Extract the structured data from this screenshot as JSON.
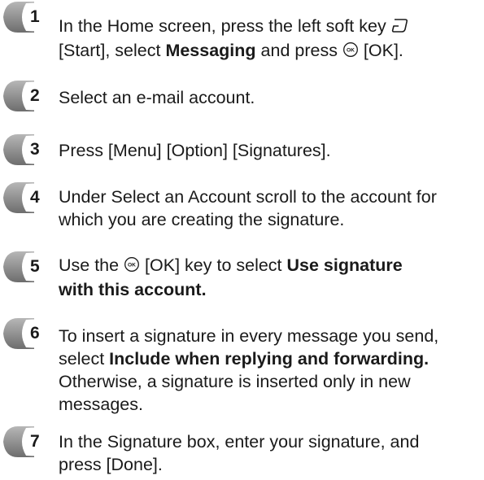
{
  "steps": [
    {
      "number": "1",
      "lines": [
        [
          {
            "t": "In the Home screen, press the left soft key "
          },
          {
            "icon": "start-soft-key-icon"
          }
        ],
        [
          {
            "t": "[Start], select "
          },
          {
            "b": "Messaging"
          },
          {
            "t": " and press "
          },
          {
            "icon": "ok-key-icon"
          },
          {
            "t": " [OK]."
          }
        ]
      ]
    },
    {
      "number": "2",
      "lines": [
        [
          {
            "t": "Select an e-mail account."
          }
        ]
      ]
    },
    {
      "number": "3",
      "lines": [
        [
          {
            "t": "Press [Menu] [Option] [Signatures]."
          }
        ]
      ]
    },
    {
      "number": "4",
      "lines": [
        [
          {
            "t": "Under Select an Account scroll to the account for"
          }
        ],
        [
          {
            "t": "which you are creating the signature."
          }
        ]
      ]
    },
    {
      "number": "5",
      "lines": [
        [
          {
            "t": "Use the "
          },
          {
            "icon": "ok-key-icon"
          },
          {
            "t": " [OK] key to select "
          },
          {
            "b": "Use signature"
          }
        ],
        [
          {
            "b": "with this account."
          }
        ]
      ]
    },
    {
      "number": "6",
      "lines": [
        [
          {
            "t": "To insert a signature in every message you send,"
          }
        ],
        [
          {
            "t": "select "
          },
          {
            "b": "Include when replying and forwarding."
          }
        ],
        [
          {
            "t": "Otherwise, a signature is inserted only in new"
          }
        ],
        [
          {
            "t": "messages."
          }
        ]
      ]
    },
    {
      "number": "7",
      "lines": [
        [
          {
            "t": "In the Signature box, enter your signature, and"
          }
        ],
        [
          {
            "t": "press [Done]."
          }
        ]
      ]
    }
  ]
}
